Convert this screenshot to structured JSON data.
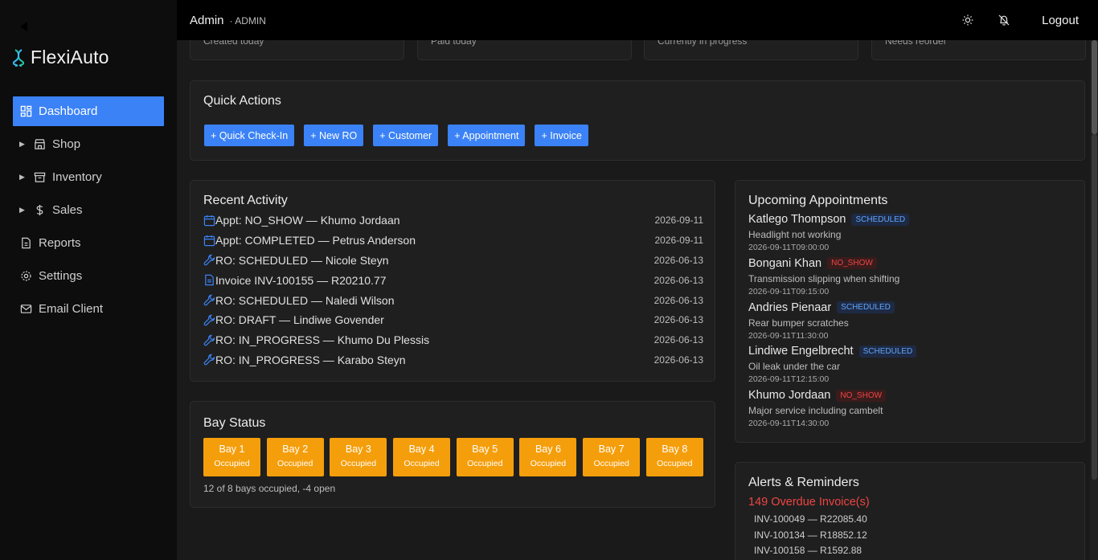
{
  "brand": {
    "name": "FlexiAuto",
    "logo_icon": "dna-icon",
    "accent": "#3b82f6"
  },
  "sidebar": {
    "items": [
      {
        "label": "Dashboard",
        "icon": "dashboard-icon",
        "active": true
      },
      {
        "label": "Shop",
        "icon": "store-icon",
        "expandable": true
      },
      {
        "label": "Inventory",
        "icon": "archive-icon",
        "expandable": true
      },
      {
        "label": "Sales",
        "icon": "dollar-icon",
        "expandable": true
      },
      {
        "label": "Reports",
        "icon": "file-icon"
      },
      {
        "label": "Settings",
        "icon": "gear-icon"
      },
      {
        "label": "Email Client",
        "icon": "mail-icon"
      }
    ]
  },
  "topbar": {
    "user": "Admin",
    "role": "· ADMIN",
    "logout": "Logout"
  },
  "stats": [
    {
      "sub": "Created today"
    },
    {
      "sub": "Paid today"
    },
    {
      "sub": "Currently in progress"
    },
    {
      "sub": "Needs reorder"
    }
  ],
  "quick_actions": {
    "title": "Quick Actions",
    "buttons": [
      "+ Quick Check-In",
      "+ New RO",
      "+ Customer",
      "+ Appointment",
      "+ Invoice"
    ]
  },
  "recent_activity": {
    "title": "Recent Activity",
    "rows": [
      {
        "icon": "calendar-icon",
        "text": "Appt: NO_SHOW — Khumo Jordaan",
        "date": "2026-09-11"
      },
      {
        "icon": "calendar-icon",
        "text": "Appt: COMPLETED — Petrus Anderson",
        "date": "2026-09-11"
      },
      {
        "icon": "wrench-icon",
        "text": "RO: SCHEDULED — Nicole Steyn",
        "date": "2026-06-13"
      },
      {
        "icon": "document-icon",
        "text": "Invoice INV-100155 — R20210.77",
        "date": "2026-06-13"
      },
      {
        "icon": "wrench-icon",
        "text": "RO: SCHEDULED — Naledi Wilson",
        "date": "2026-06-13"
      },
      {
        "icon": "wrench-icon",
        "text": "RO: DRAFT — Lindiwe Govender",
        "date": "2026-06-13"
      },
      {
        "icon": "wrench-icon",
        "text": "RO: IN_PROGRESS — Khumo Du Plessis",
        "date": "2026-06-13"
      },
      {
        "icon": "wrench-icon",
        "text": "RO: IN_PROGRESS — Karabo Steyn",
        "date": "2026-06-13"
      }
    ]
  },
  "bay_status": {
    "title": "Bay Status",
    "bays": [
      {
        "name": "Bay 1",
        "status": "Occupied"
      },
      {
        "name": "Bay 2",
        "status": "Occupied"
      },
      {
        "name": "Bay 3",
        "status": "Occupied"
      },
      {
        "name": "Bay 4",
        "status": "Occupied"
      },
      {
        "name": "Bay 5",
        "status": "Occupied"
      },
      {
        "name": "Bay 6",
        "status": "Occupied"
      },
      {
        "name": "Bay 7",
        "status": "Occupied"
      },
      {
        "name": "Bay 8",
        "status": "Occupied"
      }
    ],
    "summary": "12 of 8 bays occupied, -4 open",
    "occupied_color": "#f59e0b"
  },
  "upcoming_appointments": {
    "title": "Upcoming Appointments",
    "items": [
      {
        "name": "Katlego Thompson",
        "badge": "SCHEDULED",
        "desc": "Headlight not working",
        "when": "2026-09-11T09:00:00"
      },
      {
        "name": "Bongani Khan",
        "badge": "NO_SHOW",
        "desc": "Transmission slipping when shifting",
        "when": "2026-09-11T09:15:00"
      },
      {
        "name": "Andries Pienaar",
        "badge": "SCHEDULED",
        "desc": "Rear bumper scratches",
        "when": "2026-09-11T11:30:00"
      },
      {
        "name": "Lindiwe Engelbrecht",
        "badge": "SCHEDULED",
        "desc": "Oil leak under the car",
        "when": "2026-09-11T12:15:00"
      },
      {
        "name": "Khumo Jordaan",
        "badge": "NO_SHOW",
        "desc": "Major service including cambelt",
        "when": "2026-09-11T14:30:00"
      }
    ]
  },
  "alerts": {
    "title": "Alerts & Reminders",
    "overdue": "149 Overdue Invoice(s)",
    "invoices": [
      "INV-100049 — R22085.40",
      "INV-100134 — R18852.12",
      "INV-100158 — R1592.88"
    ]
  }
}
